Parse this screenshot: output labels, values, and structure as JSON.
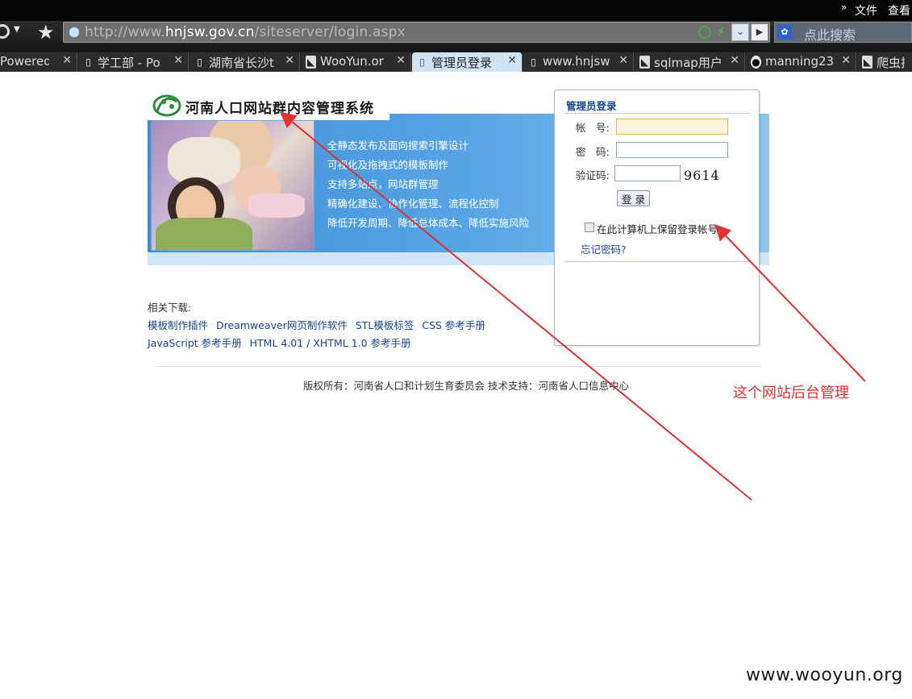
{
  "menubar": {
    "items": [
      "文件",
      "查看"
    ]
  },
  "addressbar": {
    "url_prefix": "http://www.",
    "url_domain": "hnjsw.gov.cn",
    "url_path": "/siteserver/login.aspx",
    "search_placeholder": "点此搜索"
  },
  "tabs": [
    {
      "label": "Powered b",
      "icon": "page-icon"
    },
    {
      "label": "学工部 - Po",
      "icon": "page-icon"
    },
    {
      "label": "湖南省长沙t",
      "icon": "page-icon"
    },
    {
      "label": "WooYun.or",
      "icon": "wooyun-icon"
    },
    {
      "label": "管理员登录",
      "icon": "page-icon",
      "active": true
    },
    {
      "label": "www.hnjsw",
      "icon": "page-icon"
    },
    {
      "label": "sqlmap用户",
      "icon": "wooyun-icon"
    },
    {
      "label": "manning23",
      "icon": "github-icon"
    },
    {
      "label": "爬虫技",
      "icon": "wooyun-icon"
    }
  ],
  "site": {
    "title": "河南人口网站群内容管理系统",
    "features": [
      "全静态发布及面向搜索引擎设计",
      "可视化及拖拽式的模板制作",
      "支持多站点，网站群管理",
      "精确化建设、协作化管理、流程化控制",
      "降低开发周期、降低总体成本、降低实施风险"
    ]
  },
  "login": {
    "title": "管理员登录",
    "account_label": "帐　号:",
    "password_label": "密　码:",
    "captcha_label": "验证码:",
    "captcha_code": "9614",
    "submit_label": "登 录",
    "remember_label": "在此计算机上保留登录帐号",
    "forgot_label": "忘记密码?"
  },
  "downloads": {
    "heading": "相关下载:",
    "links": [
      "模板制作插件",
      "Dreamweaver网页制作软件",
      "STL模板标签",
      "CSS 参考手册",
      "JavaScript 参考手册",
      "HTML 4.01 / XHTML 1.0 参考手册"
    ]
  },
  "footer": {
    "copyright": "版权所有：河南省人口和计划生育委员会 技术支持：河南省人口信息中心"
  },
  "annotation": {
    "text": "这个网站后台管理",
    "color": "#e0322f"
  },
  "watermark": "www.wooyun.org"
}
